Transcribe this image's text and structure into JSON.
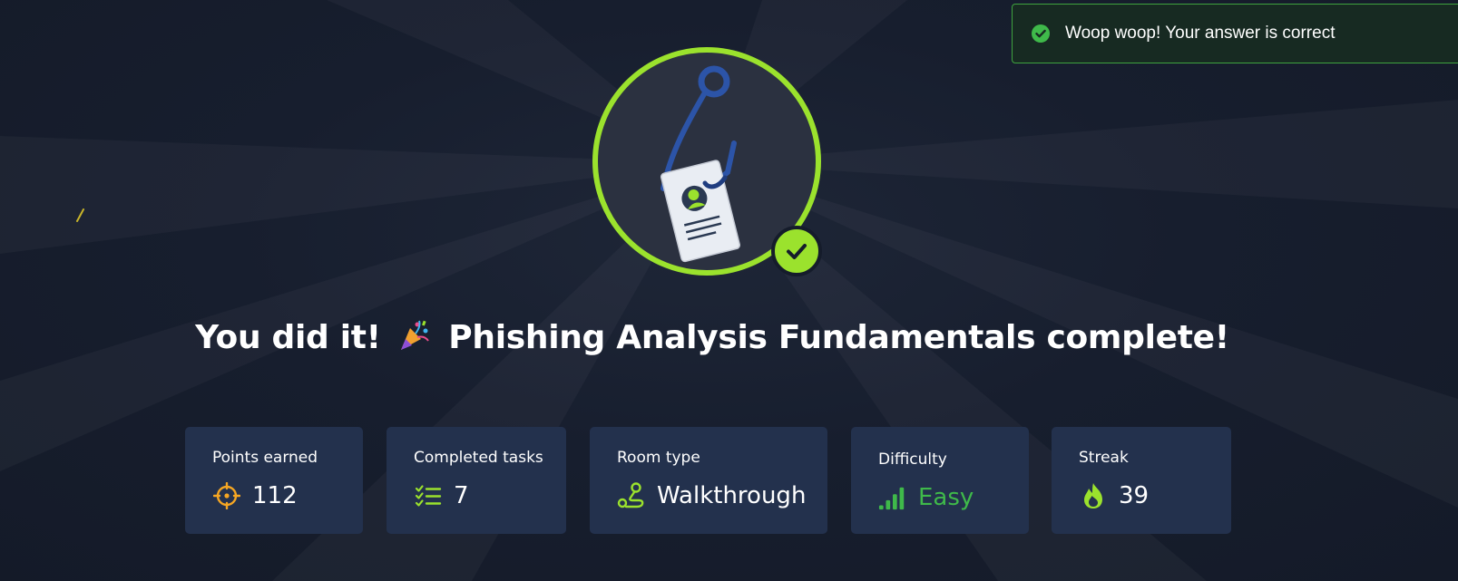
{
  "toast": {
    "message": "Woop woop! Your answer is correct",
    "color": "#3fa33f"
  },
  "completion": {
    "title_prefix": "You did it!",
    "title_suffix": "Phishing Analysis Fundamentals complete!",
    "emoji": "party-popper-icon",
    "badge_accent": "#9be22d"
  },
  "stats": [
    {
      "label": "Points earned",
      "value": "112",
      "icon": "target-icon"
    },
    {
      "label": "Completed tasks",
      "value": "7",
      "icon": "checklist-icon"
    },
    {
      "label": "Room type",
      "value": "Walkthrough",
      "icon": "route-icon"
    },
    {
      "label": "Difficulty",
      "value": "Easy",
      "icon": "signal-bars-icon",
      "color": "#3fb94a"
    },
    {
      "label": "Streak",
      "value": "39",
      "icon": "flame-icon"
    }
  ],
  "colors": {
    "background": "#151c2b",
    "card": "#23314d",
    "accent_green": "#9be22d",
    "target_orange": "#f5a623"
  }
}
